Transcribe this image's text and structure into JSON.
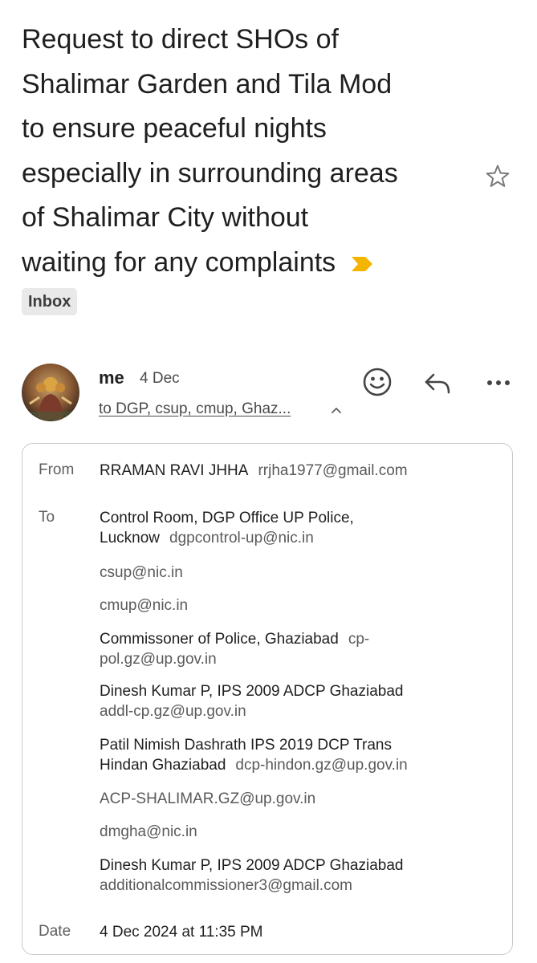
{
  "subject": {
    "text": "Request to direct SHOs of\nShalimar Garden and Tila Mod\nto ensure peaceful nights\nespecially in surrounding areas\nof Shalimar City without\nwaiting for any complaints",
    "importance_icon": "importance-marker-icon",
    "star_icon": "star-outline-icon",
    "importance_color": "#f4b400"
  },
  "label": "Inbox",
  "message": {
    "sender": "me",
    "date": "4 Dec",
    "recipients_summary": "to DGP, csup, cmup, Ghaz...",
    "actions": [
      "emoji-react-icon",
      "reply-icon",
      "more-icon"
    ]
  },
  "details": {
    "from_label": "From",
    "from": {
      "name": "RRAMAN RAVI JHHA",
      "email": "rrjha1977@gmail.com"
    },
    "to_label": "To",
    "to": [
      {
        "line1": "Control Room, DGP Office UP Police,",
        "name2": "Lucknow",
        "email": "dgpcontrol-up@nic.in"
      },
      {
        "email": "csup@nic.in"
      },
      {
        "email": "cmup@nic.in"
      },
      {
        "name": "Commissoner of Police, Ghaziabad",
        "email_part1": "cp-",
        "email_part2": "pol.gz@up.gov.in"
      },
      {
        "name": "Dinesh Kumar P, IPS 2009 ADCP Ghaziabad",
        "email": "addl-cp.gz@up.gov.in"
      },
      {
        "line1": "Patil Nimish Dashrath IPS 2019 DCP Trans",
        "name2": "Hindan Ghaziabad",
        "email": "dcp-hindon.gz@up.gov.in"
      },
      {
        "email": "ACP-SHALIMAR.GZ@up.gov.in"
      },
      {
        "email": "dmgha@nic.in"
      },
      {
        "name": "Dinesh Kumar P, IPS 2009 ADCP Ghaziabad",
        "email": "additionalcommissioner3@gmail.com"
      }
    ],
    "date_label": "Date",
    "date": "4 Dec 2024 at 11:35 PM"
  }
}
